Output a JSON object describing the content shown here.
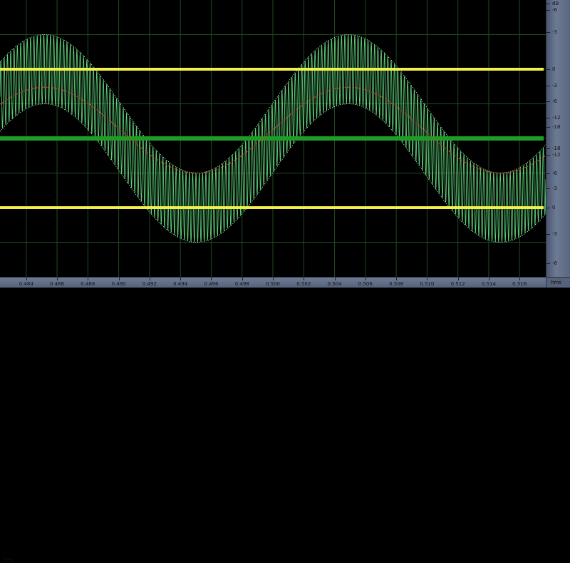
{
  "colors": {
    "background": "#000000",
    "grid": "#1f4a22",
    "waveform": "#5fd07a",
    "waveform_edge": "#b9f5c6",
    "rms_trace": "#d8402a",
    "marker_yellow": "#f2f04a",
    "marker_green": "#1f9c25"
  },
  "waveform": {
    "envelope_center": 0.5,
    "envelope_amplitude": 0.25,
    "half_height": 0.125,
    "envelope_period_ms": 0.0197,
    "envelope_peak_time": 0.4852,
    "carrier_cycles_visible": 165,
    "trace_min_db": -6.7,
    "trace_max_db": -3.3
  },
  "markers": [
    {
      "name": "upper-yellow-marker",
      "level": 0.75,
      "color": "marker_yellow"
    },
    {
      "name": "center-green-marker",
      "level": 0.5,
      "color": "marker_green"
    },
    {
      "name": "lower-yellow-marker",
      "level": 0.25,
      "color": "marker_yellow"
    }
  ],
  "time_axis": {
    "unit_left": "hms",
    "unit_right": "hms",
    "start": 0.4823,
    "end": 0.5177,
    "ticks": [
      "0.484",
      "0.486",
      "0.488",
      "0.490",
      "0.492",
      "0.494",
      "0.496",
      "0.498",
      "0.500",
      "0.502",
      "0.504",
      "0.506",
      "0.508",
      "0.510",
      "0.512",
      "0.514",
      "0.516"
    ]
  },
  "db_axis": {
    "labels": [
      {
        "text": "dB",
        "value": 1.0
      },
      {
        "text": "-6",
        "value": 0.965
      },
      {
        "text": "-3",
        "value": 0.885
      },
      {
        "text": "0",
        "value": 0.75
      },
      {
        "text": "-3",
        "value": 0.69
      },
      {
        "text": "-6",
        "value": 0.635
      },
      {
        "text": "-12",
        "value": 0.575
      },
      {
        "text": "-18",
        "value": 0.54
      },
      {
        "text": "-18",
        "value": 0.465
      },
      {
        "text": "-12",
        "value": 0.44
      },
      {
        "text": "-6",
        "value": 0.375
      },
      {
        "text": "-3",
        "value": 0.32
      },
      {
        "text": "0",
        "value": 0.25
      },
      {
        "text": "-3",
        "value": 0.155
      },
      {
        "text": "-6",
        "value": 0.05
      }
    ]
  }
}
